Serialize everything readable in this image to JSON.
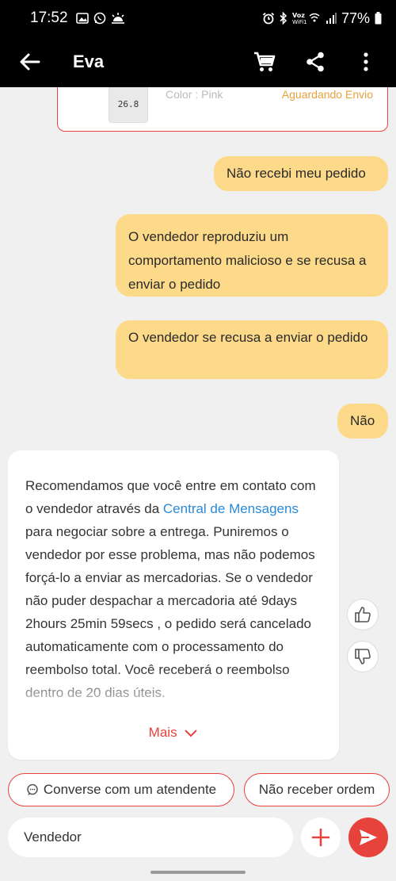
{
  "status_bar": {
    "time": "17:52",
    "volte": "Voz\nWiFi1",
    "battery": "77%"
  },
  "app_bar": {
    "title": "Eva",
    "icons": [
      "back-arrow-icon",
      "cart-icon",
      "share-icon",
      "more-vert-icon"
    ]
  },
  "order_card": {
    "thumb_text": "26.8",
    "variant": "Color : Pink",
    "status": "Aguardando Envio"
  },
  "messages": [
    {
      "from": "user",
      "text": "Não recebi meu pedido"
    },
    {
      "from": "user",
      "text": "O vendedor reproduziu um comportamento malicioso e se recusa a enviar o pedido"
    },
    {
      "from": "user",
      "text": "O vendedor se recusa a enviar o pedido"
    },
    {
      "from": "user",
      "text": "Não"
    }
  ],
  "reply": {
    "part1": "Recomendamos que você entre em contato com o vendedor através da ",
    "link": "Central de Mensagens",
    "part2": " para negociar sobre a entrega. Puniremos o vendedor por esse problema, mas não podemos forçá-lo a enviar as mercadorias. Se o vendedor não puder despachar a mercadoria até 9days 2hours 25min 59secs , o pedido será cancelado automaticamente com o processamento do reembolso total. Você receberá o reembolso dentro de 20 dias úteis.",
    "more_label": "Mais"
  },
  "quick_replies": {
    "agent": "Converse com um atendente",
    "no_order": "Não receber ordem"
  },
  "input": {
    "value": "Vendedor"
  },
  "colors": {
    "accent": "#e8423c",
    "user_bubble": "#fdd98a",
    "link": "#2b89d6"
  }
}
